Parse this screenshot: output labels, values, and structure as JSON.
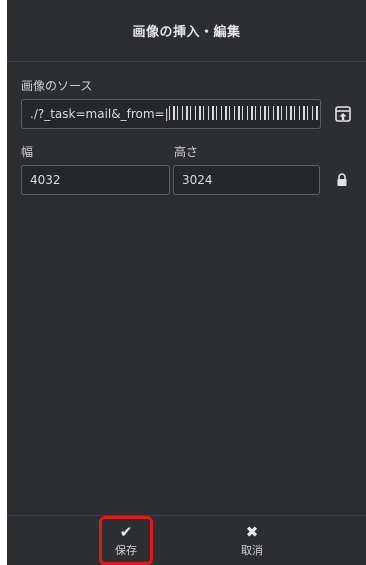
{
  "dialog": {
    "title": "画像の挿入・編集",
    "source_label": "画像のソース",
    "source_value": "./?_task=mail&_from=|",
    "width_label": "幅",
    "width_value": "4032",
    "height_label": "高さ",
    "height_value": "3024"
  },
  "icons": {
    "upload": "upload-icon",
    "lock": "lock-icon",
    "save": "check-icon",
    "cancel": "close-icon"
  },
  "footer": {
    "save_label": "保存",
    "cancel_label": "取消"
  },
  "colors": {
    "background": "#2d2e31",
    "highlight": "#e0191b"
  }
}
